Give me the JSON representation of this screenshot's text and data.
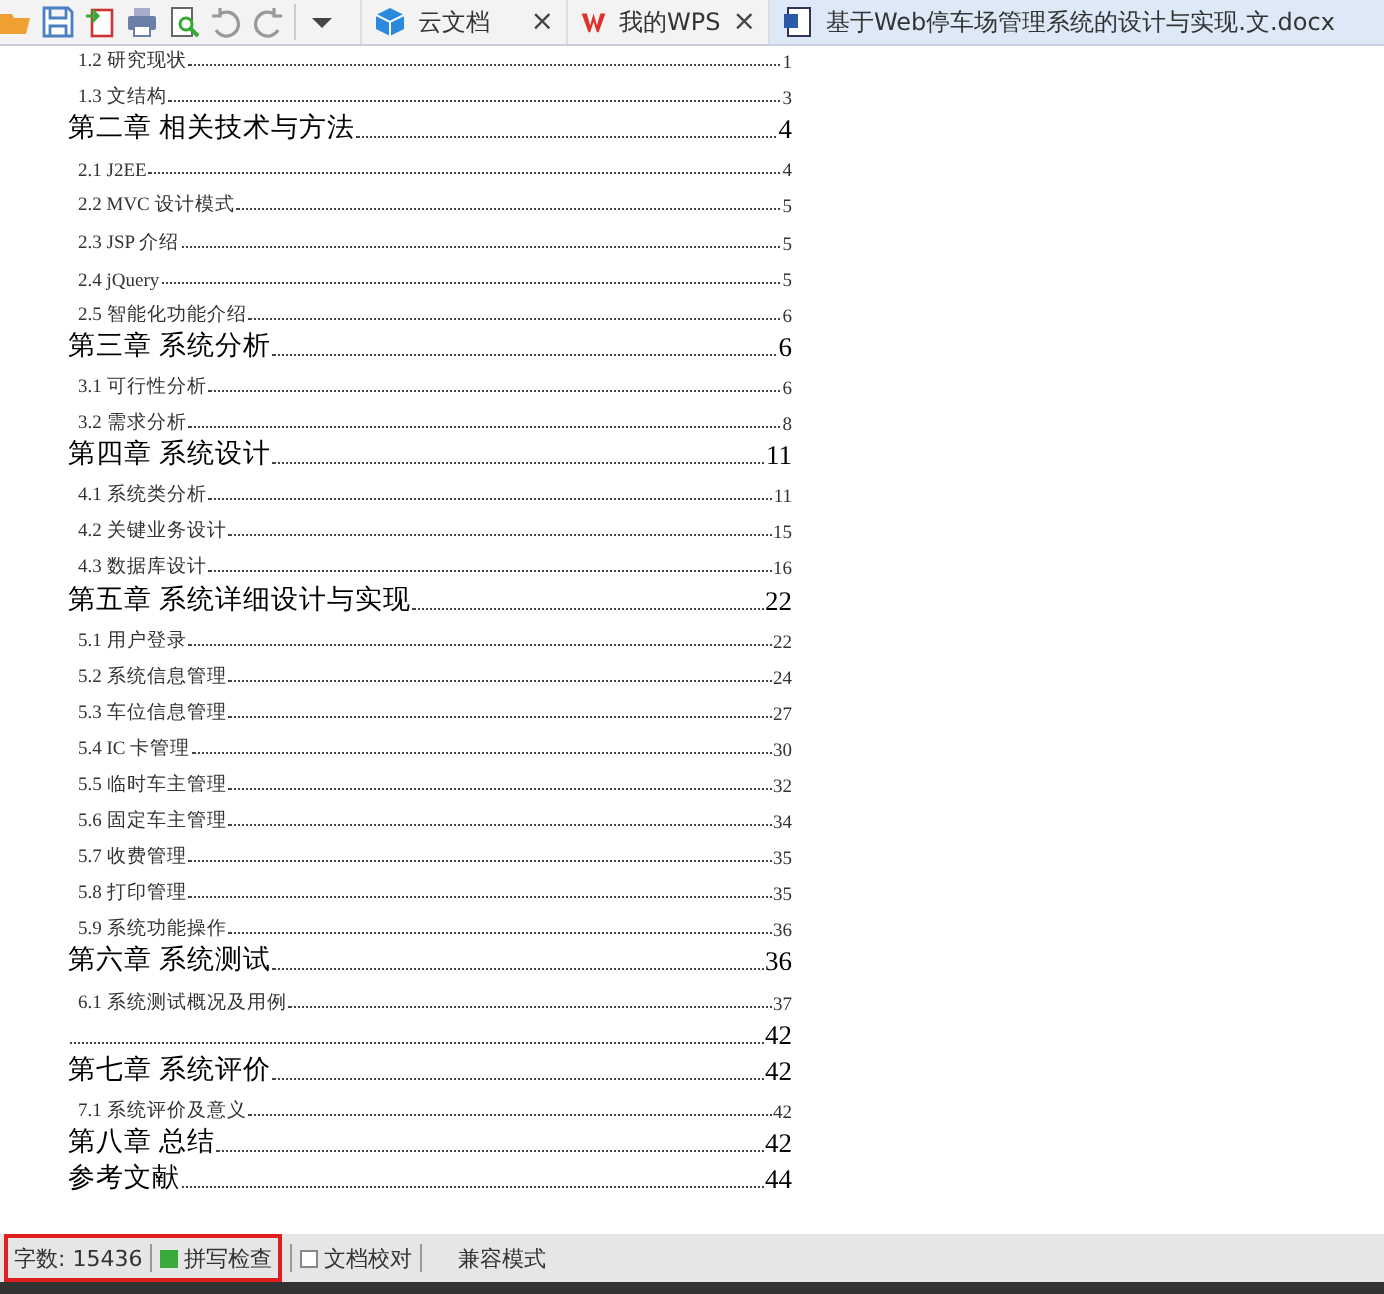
{
  "tabs": [
    {
      "label": "云文档",
      "kind": "cloud",
      "selected": false,
      "close": "×"
    },
    {
      "label": "我的WPS",
      "kind": "wps",
      "selected": false,
      "close": "×"
    },
    {
      "label": "基于Web停车场管理系统的设计与实现.文.docx",
      "kind": "doc",
      "selected": true
    }
  ],
  "toc": [
    {
      "kind": "section",
      "title": "1.2 研究现状",
      "page": "1"
    },
    {
      "kind": "section",
      "title": "1.3 文结构",
      "page": "3"
    },
    {
      "kind": "chapter",
      "title": "第二章  相关技术与方法",
      "page": "4"
    },
    {
      "kind": "section",
      "title": "2.1 J2EE",
      "page": "4"
    },
    {
      "kind": "section",
      "title": "2.2 MVC 设计模式",
      "page": "5"
    },
    {
      "kind": "section",
      "title": "2.3 JSP 介绍",
      "page": "5"
    },
    {
      "kind": "section",
      "title": "2.4 jQuery",
      "page": "5"
    },
    {
      "kind": "section",
      "title": "2.5  智能化功能介绍",
      "page": "6"
    },
    {
      "kind": "chapter",
      "title": "第三章  系统分析",
      "page": "6"
    },
    {
      "kind": "section",
      "title": "3.1 可行性分析",
      "page": "6"
    },
    {
      "kind": "section",
      "title": "3.2 需求分析",
      "page": "8"
    },
    {
      "kind": "chapter",
      "title": "第四章  系统设计",
      "page": "11"
    },
    {
      "kind": "section",
      "title": "4.1 系统类分析",
      "page": "11"
    },
    {
      "kind": "section",
      "title": "4.2 关键业务设计",
      "page": "15"
    },
    {
      "kind": "section",
      "title": "4.3 数据库设计",
      "page": "16"
    },
    {
      "kind": "chapter",
      "title": "第五章  系统详细设计与实现",
      "page": "22"
    },
    {
      "kind": "section",
      "title": "5.1 用户登录",
      "page": "22"
    },
    {
      "kind": "section",
      "title": "5.2 系统信息管理",
      "page": "24"
    },
    {
      "kind": "section",
      "title": "5.3 车位信息管理",
      "page": "27"
    },
    {
      "kind": "section",
      "title": "5.4 IC 卡管理",
      "page": "30"
    },
    {
      "kind": "section",
      "title": "5.5 临时车主管理",
      "page": "32"
    },
    {
      "kind": "section",
      "title": "5.6 固定车主管理",
      "page": "34"
    },
    {
      "kind": "section",
      "title": "5.7 收费管理",
      "page": "35"
    },
    {
      "kind": "section",
      "title": "5.8 打印管理",
      "page": "35"
    },
    {
      "kind": "section",
      "title": "5.9 系统功能操作",
      "page": "36"
    },
    {
      "kind": "chapter",
      "title": "第六章  系统测试",
      "page": "36"
    },
    {
      "kind": "section",
      "title": "6.1 系统测试概况及用例",
      "page": "37"
    },
    {
      "kind": "chapter",
      "page": "42"
    },
    {
      "kind": "chapter",
      "title": "第七章  系统评价",
      "page": "42"
    },
    {
      "kind": "section",
      "title": "7.1 系统评价及意义",
      "page": "42"
    },
    {
      "kind": "chapter",
      "title": "第八章  总结",
      "page": "42"
    },
    {
      "kind": "chapter",
      "title": "参考文献",
      "page": "44"
    }
  ],
  "status_bar": {
    "word_count": "字数: 15436",
    "spell_check": {
      "label": "拼写检查",
      "checked": true
    },
    "proofread": {
      "label": "文档校对",
      "checked": false
    },
    "mode": "兼容模式"
  }
}
